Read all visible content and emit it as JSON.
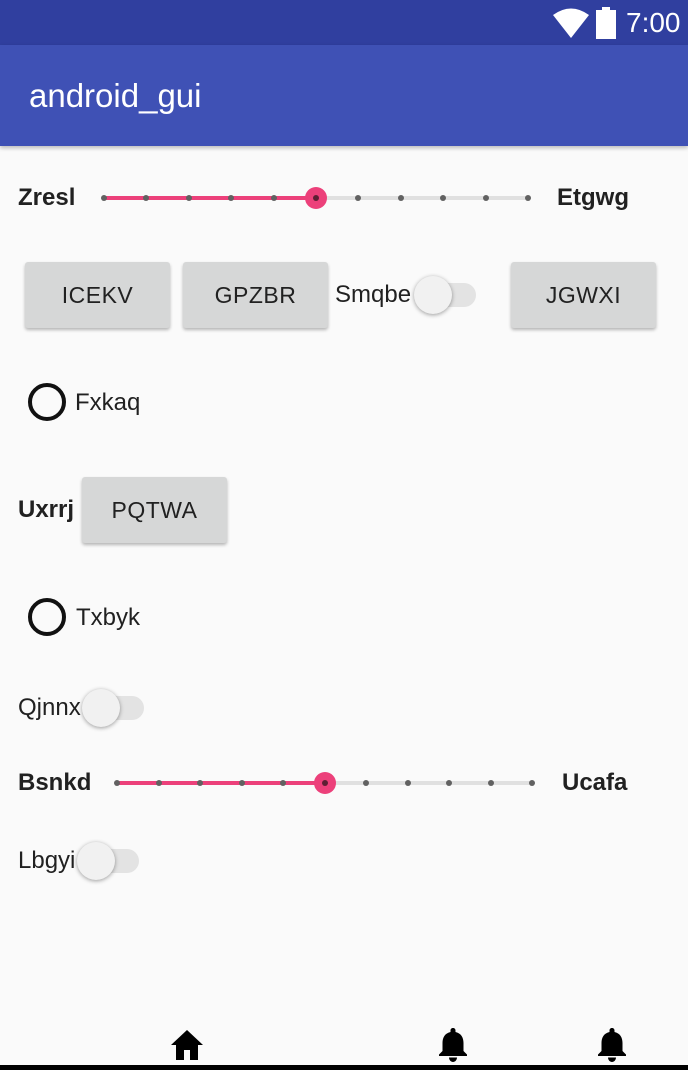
{
  "status_bar": {
    "time": "7:00",
    "wifi_icon": "wifi-icon",
    "battery_icon": "battery-icon"
  },
  "app_bar": {
    "title": "android_gui"
  },
  "colors": {
    "status_bar": "#303f9f",
    "app_bar": "#3f51b5",
    "accent": "#ec407a",
    "background": "#fafafa",
    "button": "#d6d7d7"
  },
  "content": {
    "seekbar_1": {
      "left_label": "Zresl",
      "right_label": "Etgwg",
      "value": 5,
      "max": 10
    },
    "buttons_row": {
      "button_1": "ICEKV",
      "button_2": "GPZBR",
      "switch_label": "Smqbe",
      "switch_on": false,
      "button_3": "JGWXI"
    },
    "radio_1": {
      "label": "Fxkaq",
      "checked": false
    },
    "button_row_2": {
      "label": "Uxrrj",
      "button": "PQTWA"
    },
    "radio_2": {
      "label": "Txbyk",
      "checked": false
    },
    "switch_2": {
      "label": "Qjnnx",
      "on": false
    },
    "seekbar_2": {
      "left_label": "Bsnkd",
      "right_label": "Ucafa",
      "value": 5,
      "max": 10
    },
    "switch_3": {
      "label": "Lbgyi",
      "on": false
    }
  },
  "bottom_nav": {
    "items": [
      {
        "icon": "home-icon"
      },
      {
        "icon": "bell-icon"
      },
      {
        "icon": "bell-icon"
      }
    ]
  }
}
